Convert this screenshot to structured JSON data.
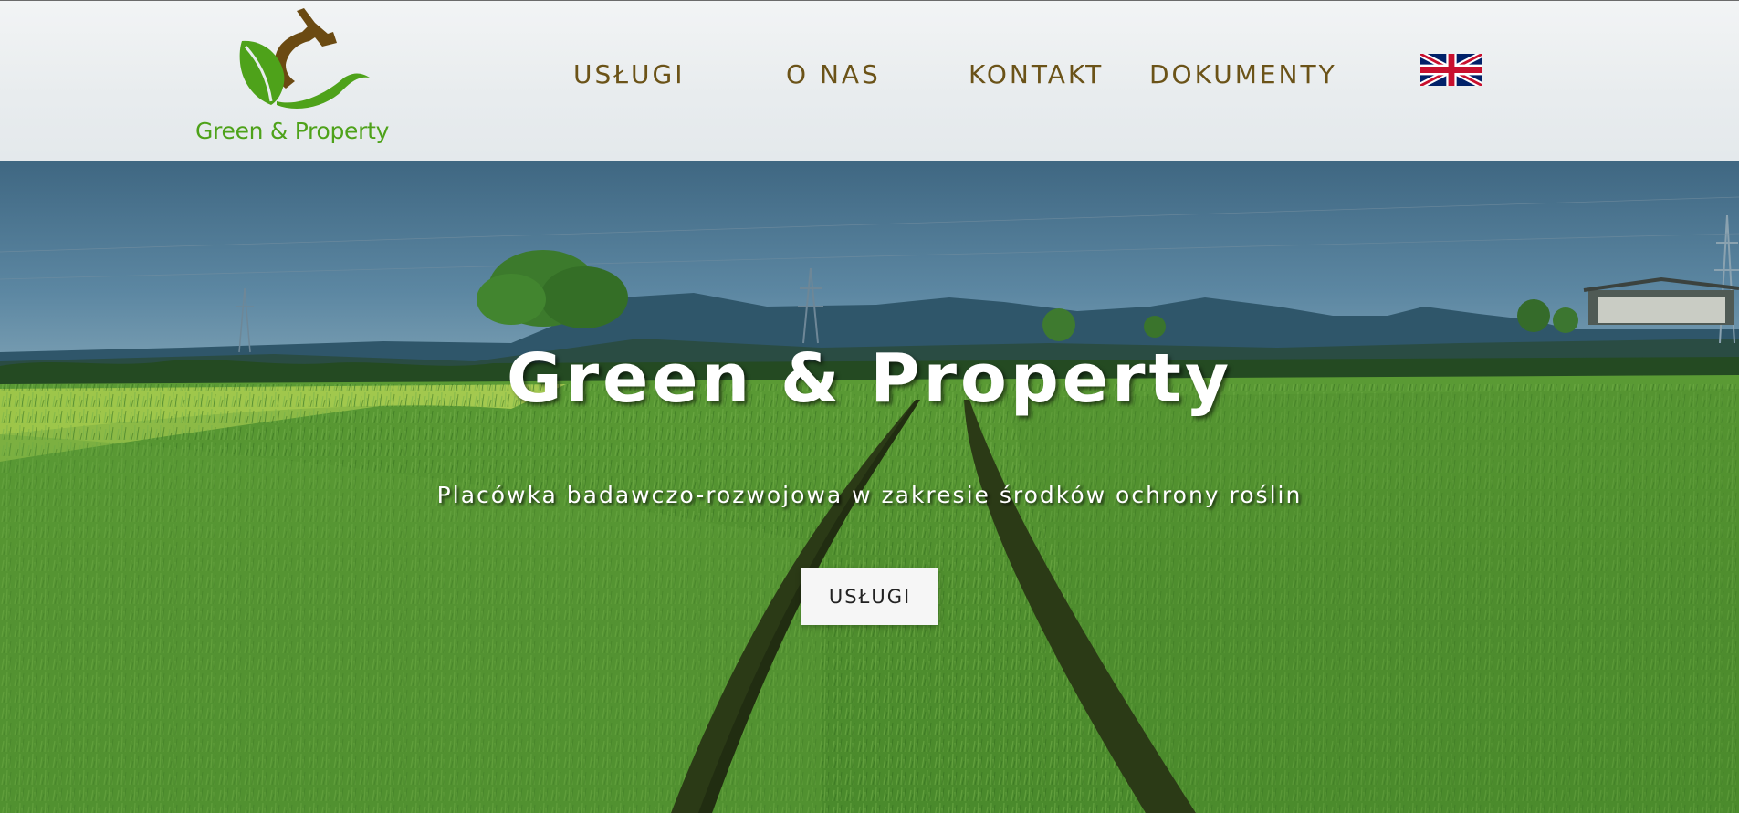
{
  "header": {
    "logo": {
      "text": "Green & Property",
      "icon": "leaf-and-sprayer-logo-icon",
      "colors": {
        "green": "#4ea21a",
        "brown": "#6b4a12"
      }
    },
    "nav": [
      {
        "label": "USŁUGI"
      },
      {
        "label": "O NAS"
      },
      {
        "label": "KONTAKT"
      },
      {
        "label": "DOKUMENTY"
      }
    ],
    "language_switch": {
      "icon": "uk-flag-icon"
    },
    "nav_color": "#6b5318"
  },
  "hero": {
    "title": "Green & Property",
    "subtitle": "Placówka badawczo-rozwojowa w zakresie środków ochrony roślin",
    "button_label": "USŁUGI",
    "background": "green-wheat-field-with-mountains-image"
  }
}
